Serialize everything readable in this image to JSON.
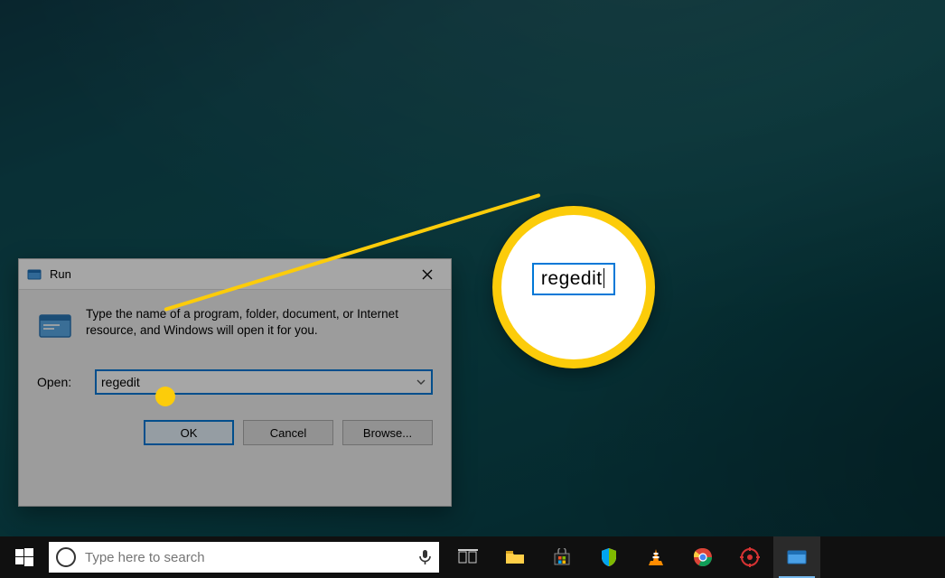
{
  "dialog": {
    "title": "Run",
    "description": "Type the name of a program, folder, document, or Internet resource, and Windows will open it for you.",
    "open_label": "Open:",
    "open_value": "regedit",
    "buttons": {
      "ok": "OK",
      "cancel": "Cancel",
      "browse": "Browse..."
    }
  },
  "magnifier": {
    "peek_text": "",
    "value": "regedit"
  },
  "taskbar": {
    "search_placeholder": "Type here to search",
    "apps": [
      {
        "name": "task-view"
      },
      {
        "name": "file-explorer"
      },
      {
        "name": "microsoft-store"
      },
      {
        "name": "security-center"
      },
      {
        "name": "vlc"
      },
      {
        "name": "chrome"
      },
      {
        "name": "settings-gear"
      },
      {
        "name": "run-dialog"
      }
    ]
  },
  "colors": {
    "accent": "#fccc0a",
    "win_blue": "#0078d7"
  }
}
